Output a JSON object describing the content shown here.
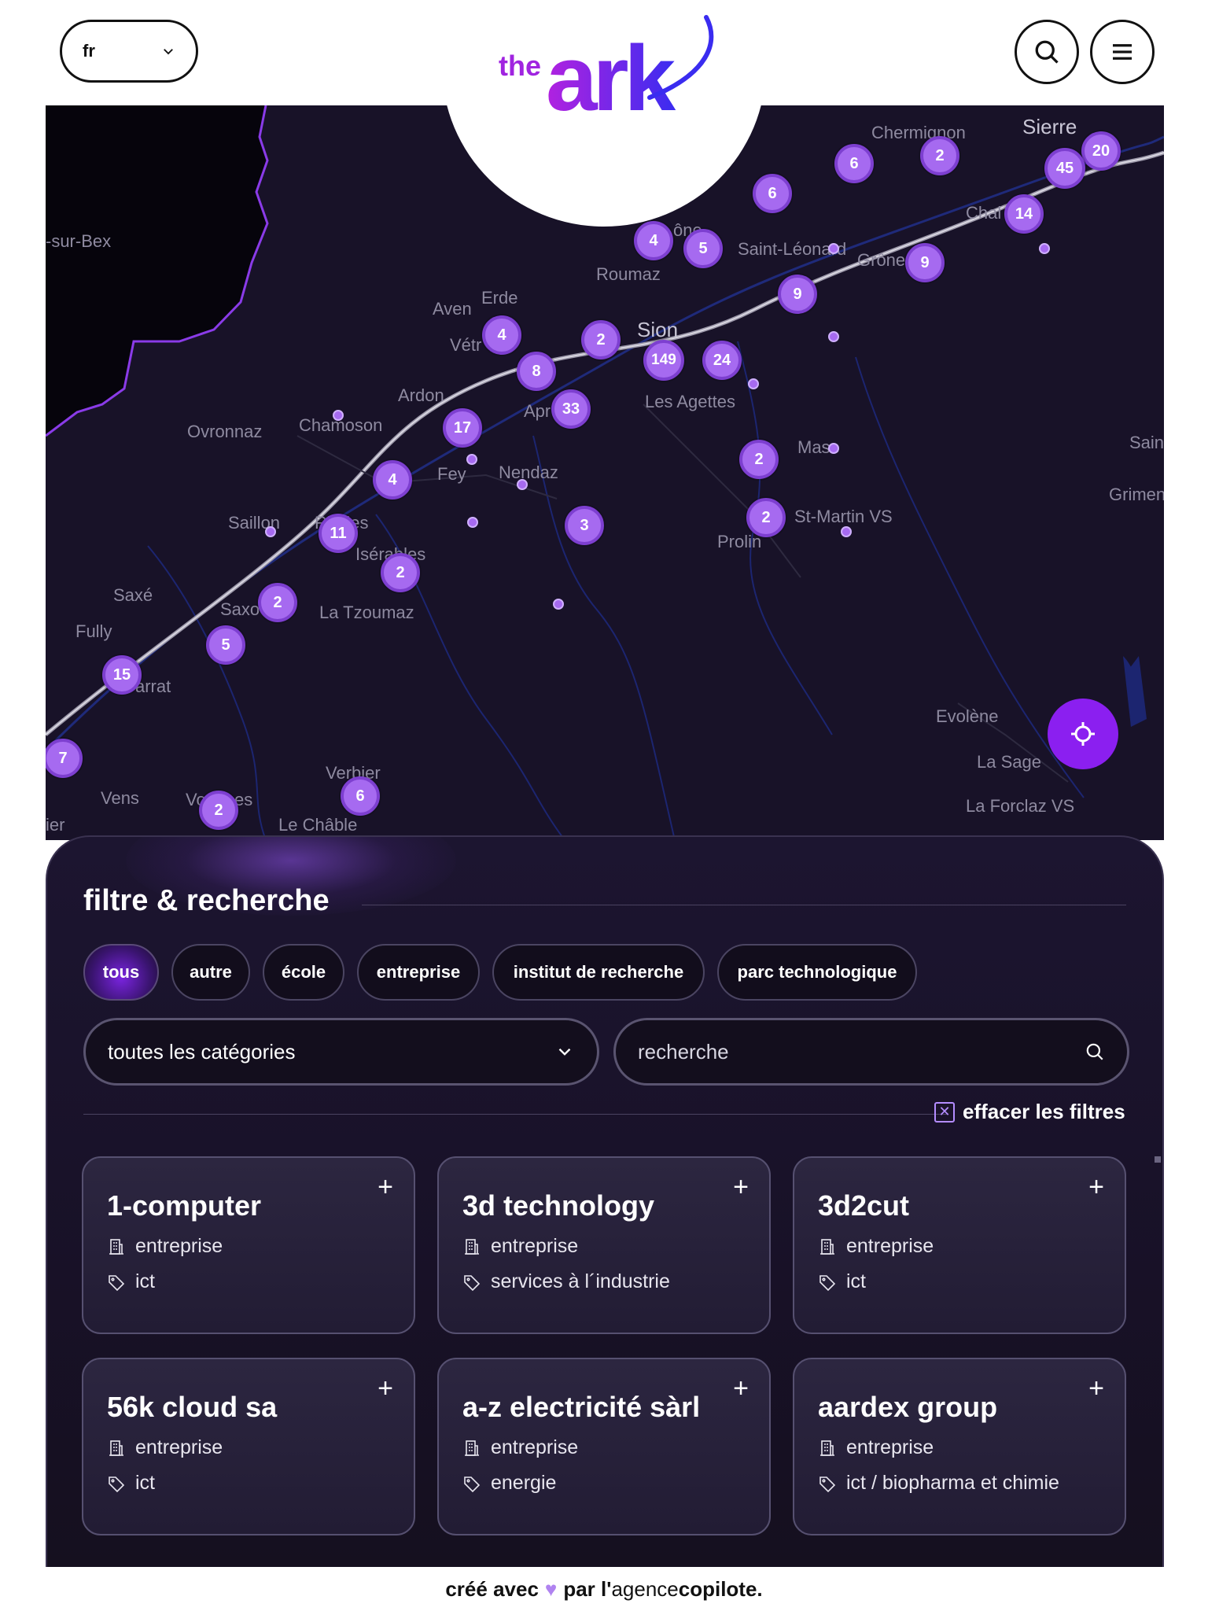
{
  "header": {
    "language": "fr",
    "logo_prefix": "the",
    "logo_word": "ark",
    "search_icon": "search-icon",
    "menu_icon": "hamburger-menu-icon"
  },
  "map": {
    "places": [
      {
        "name": "Chermignon",
        "big": false
      },
      {
        "name": "Sierre",
        "big": true
      },
      {
        "name": "Chal",
        "big": false
      },
      {
        "name": "-sur-Bex",
        "big": false
      },
      {
        "name": "Saint-Léonard",
        "big": false
      },
      {
        "name": "Grône",
        "big": false
      },
      {
        "name": "ône",
        "big": false
      },
      {
        "name": "Roumaz",
        "big": false
      },
      {
        "name": "Erde",
        "big": false
      },
      {
        "name": "Aven",
        "big": false
      },
      {
        "name": "Vétr",
        "big": false
      },
      {
        "name": "Sion",
        "big": true
      },
      {
        "name": "Les Agettes",
        "big": false
      },
      {
        "name": "Ardon",
        "big": false
      },
      {
        "name": "Apr",
        "big": false
      },
      {
        "name": "Ovronnaz",
        "big": false
      },
      {
        "name": "Chamoson",
        "big": false
      },
      {
        "name": "Fey",
        "big": false
      },
      {
        "name": "Nendaz",
        "big": false
      },
      {
        "name": "Mase",
        "big": false
      },
      {
        "name": "Sain",
        "big": false
      },
      {
        "name": "Grimen",
        "big": false
      },
      {
        "name": "Saillon",
        "big": false
      },
      {
        "name": "Riddes",
        "big": false
      },
      {
        "name": "Isérables",
        "big": false
      },
      {
        "name": "St-Martin VS",
        "big": false
      },
      {
        "name": "Prolin",
        "big": false
      },
      {
        "name": "Saxé",
        "big": false
      },
      {
        "name": "Saxo",
        "big": false
      },
      {
        "name": "La Tzoumaz",
        "big": false
      },
      {
        "name": "Fully",
        "big": false
      },
      {
        "name": "arrat",
        "big": false
      },
      {
        "name": "Evolène",
        "big": false
      },
      {
        "name": "La Sage",
        "big": false
      },
      {
        "name": "Verbier",
        "big": false
      },
      {
        "name": "Vens",
        "big": false
      },
      {
        "name": "Vo",
        "big": false
      },
      {
        "name": "es",
        "big": false
      },
      {
        "name": "Le Châble",
        "big": false
      },
      {
        "name": "La Forclaz VS",
        "big": false
      },
      {
        "name": "ier",
        "big": false
      }
    ],
    "clusters": [
      "6",
      "2",
      "20",
      "45",
      "6",
      "14",
      "4",
      "5",
      "9",
      "9",
      "2",
      "149",
      "24",
      "4",
      "8",
      "33",
      "17",
      "4",
      "2",
      "2",
      "3",
      "11",
      "2",
      "2",
      "5",
      "15",
      "7",
      "2",
      "6"
    ],
    "locate_icon": "crosshair-icon"
  },
  "filters": {
    "title": "filtre & recherche",
    "chips": [
      "tous",
      "autre",
      "école",
      "entreprise",
      "institut de recherche",
      "parc technologique"
    ],
    "active_chip": "tous",
    "category_select": "toutes les catégories",
    "search_placeholder": "recherche",
    "clear_label": "effacer les filtres"
  },
  "cards": [
    {
      "name": "1-computer",
      "type": "entreprise",
      "sector": "ict"
    },
    {
      "name": "3d technology",
      "type": "entreprise",
      "sector": "services à l´industrie"
    },
    {
      "name": "3d2cut",
      "type": "entreprise",
      "sector": "ict"
    },
    {
      "name": "56k cloud sa",
      "type": "entreprise",
      "sector": "ict"
    },
    {
      "name": "a-z electricité sàrl",
      "type": "entreprise",
      "sector": "energie"
    },
    {
      "name": "aardex group",
      "type": "entreprise",
      "sector": "ict / biopharma et chimie"
    }
  ],
  "footer": {
    "text1": "créé avec",
    "heart": "♥",
    "text2": "par l'",
    "brand_a": "agence",
    "brand_b": "copilote."
  },
  "colors": {
    "accent": "#8b1ff0",
    "cluster": "#a66af0",
    "map_bg": "#181228",
    "panel_bg": "#1c1530"
  }
}
